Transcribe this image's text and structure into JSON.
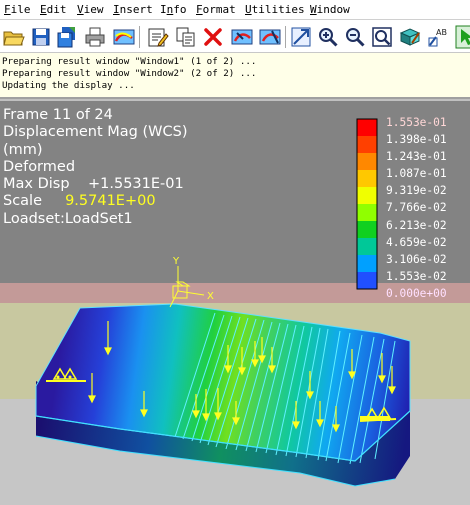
{
  "menu": {
    "items": [
      {
        "ul": "F",
        "rest": "ile"
      },
      {
        "ul": "E",
        "rest": "dit"
      },
      {
        "ul": "V",
        "rest": "iew"
      },
      {
        "ul": "I",
        "rest": "nsert"
      },
      {
        "pre": "I",
        "ul": "n",
        "rest": "fo"
      },
      {
        "ul": "F",
        "rest": "ormat"
      },
      {
        "ul": "U",
        "rest": "tilities"
      },
      {
        "ul": "W",
        "rest": "indow"
      }
    ]
  },
  "toolbar": {
    "icons": [
      "open-folder-icon",
      "save-icon",
      "save-copy-icon",
      "print-icon",
      "repaint-icon",
      "edit-icon",
      "copy-icon",
      "delete-icon",
      "spin-view-icon",
      "redraw-icon",
      "zoom-window-icon",
      "zoom-in-icon",
      "zoom-out-icon",
      "refit-icon",
      "orient-icon",
      "annotation-icon",
      "select-icon"
    ]
  },
  "messages": [
    "Preparing result window \"Window1\" (1 of 2) ...",
    "Preparing result window \"Window2\" (2 of 2) ...",
    "Updating the display ..."
  ],
  "result_info": {
    "frame": "Frame 11 of 24",
    "quantity": "Displacement Mag (WCS)",
    "units": "(mm)",
    "mode": "Deformed",
    "max_disp_label": "Max Disp",
    "max_disp_value": "+1.5531E-01",
    "scale_label": "Scale",
    "scale_value": "9.5741E+00",
    "loadset": "Loadset:LoadSet1"
  },
  "legend": {
    "values": [
      "1.553e-01",
      "1.398e-01",
      "1.243e-01",
      "1.087e-01",
      "9.319e-02",
      "7.766e-02",
      "6.213e-02",
      "4.659e-02",
      "3.106e-02",
      "1.553e-02",
      "0.000e+00"
    ],
    "colors": [
      "#ff0000",
      "#ff4000",
      "#ff8800",
      "#ffc800",
      "#f0ff00",
      "#90ff00",
      "#10d020",
      "#00c898",
      "#00a0ff",
      "#2050ff",
      "#3010d0"
    ]
  },
  "csys": {
    "y_label": "Y",
    "x_label": "X"
  },
  "colors": {
    "viewport_bg_top": "#838383",
    "viewport_bg_mid": "#c39a98",
    "viewport_bg_yellow": "#c8c8a0",
    "floor": "#c6c6c6",
    "info_text": "#ffffff",
    "info_yellow": "#ffff20"
  }
}
